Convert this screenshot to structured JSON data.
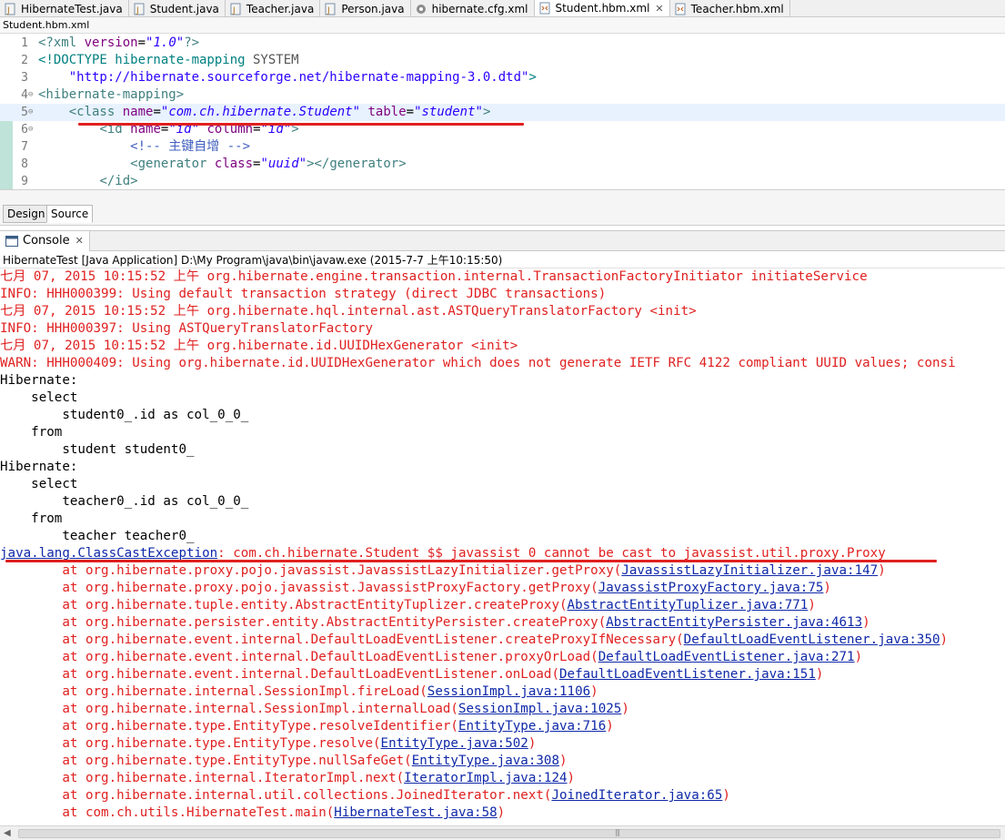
{
  "editor_tabs": [
    {
      "label": "HibernateTest.java",
      "icon": "java-file-icon"
    },
    {
      "label": "Student.java",
      "icon": "java-file-icon"
    },
    {
      "label": "Teacher.java",
      "icon": "java-file-icon"
    },
    {
      "label": "Person.java",
      "icon": "java-file-icon"
    },
    {
      "label": "hibernate.cfg.xml",
      "icon": "hibernate-config-icon"
    },
    {
      "label": "Student.hbm.xml",
      "icon": "xml-file-icon",
      "active": true
    },
    {
      "label": "Teacher.hbm.xml",
      "icon": "xml-file-icon"
    }
  ],
  "editor": {
    "title": "Student.hbm.xml",
    "lines": [
      {
        "num": "1",
        "text": "<?xml version=\"1.0\"?>"
      },
      {
        "num": "2",
        "text": "<!DOCTYPE hibernate-mapping SYSTEM"
      },
      {
        "num": "3",
        "text": "    \"http://hibernate.sourceforge.net/hibernate-mapping-3.0.dtd\">"
      },
      {
        "num": "4",
        "text": "<hibernate-mapping>"
      },
      {
        "num": "5",
        "text": "    <class name=\"com.ch.hibernate.Student\" table=\"student\">"
      },
      {
        "num": "6",
        "text": "        <id name=\"id\" column=\"id\">"
      },
      {
        "num": "7",
        "text": "            <!-- 主键自增 -->"
      },
      {
        "num": "8",
        "text": "            <generator class=\"uuid\"></generator>"
      },
      {
        "num": "9",
        "text": "        </id>"
      }
    ],
    "bottom_tabs": {
      "design": "Design",
      "source": "Source"
    }
  },
  "console": {
    "tab_label": "Console",
    "description": "HibernateTest [Java Application] D:\\My Program\\java\\bin\\javaw.exe (2015-7-7 上午10:15:50)",
    "lines": [
      {
        "type": "err",
        "text": "七月 07, 2015 10:15:52 上午 org.hibernate.engine.transaction.internal.TransactionFactoryInitiator initiateService"
      },
      {
        "type": "err",
        "text": "INFO: HHH000399: Using default transaction strategy (direct JDBC transactions)"
      },
      {
        "type": "err",
        "text": "七月 07, 2015 10:15:52 上午 org.hibernate.hql.internal.ast.ASTQueryTranslatorFactory <init>"
      },
      {
        "type": "err",
        "text": "INFO: HHH000397: Using ASTQueryTranslatorFactory"
      },
      {
        "type": "err",
        "text": "七月 07, 2015 10:15:52 上午 org.hibernate.id.UUIDHexGenerator <init>"
      },
      {
        "type": "err",
        "text": "WARN: HHH000409: Using org.hibernate.id.UUIDHexGenerator which does not generate IETF RFC 4122 compliant UUID values; consi"
      },
      {
        "type": "out",
        "text": "Hibernate: "
      },
      {
        "type": "out",
        "text": "    select"
      },
      {
        "type": "out",
        "text": "        student0_.id as col_0_0_ "
      },
      {
        "type": "out",
        "text": "    from"
      },
      {
        "type": "out",
        "text": "        student student0_"
      },
      {
        "type": "out",
        "text": "Hibernate: "
      },
      {
        "type": "out",
        "text": "    select"
      },
      {
        "type": "out",
        "text": "        teacher0_.id as col_0_0_ "
      },
      {
        "type": "out",
        "text": "    from"
      },
      {
        "type": "out",
        "text": "        teacher teacher0_"
      }
    ],
    "exception": {
      "class": "java.lang.ClassCastException",
      "message": ": com.ch.hibernate.Student_$$_javassist_0 cannot be cast to javassist.util.proxy.Proxy"
    },
    "stack": [
      {
        "prefix": "        at org.hibernate.proxy.pojo.javassist.JavassistLazyInitializer.getProxy(",
        "link": "JavassistLazyInitializer.java:147"
      },
      {
        "prefix": "        at org.hibernate.proxy.pojo.javassist.JavassistProxyFactory.getProxy(",
        "link": "JavassistProxyFactory.java:75"
      },
      {
        "prefix": "        at org.hibernate.tuple.entity.AbstractEntityTuplizer.createProxy(",
        "link": "AbstractEntityTuplizer.java:771"
      },
      {
        "prefix": "        at org.hibernate.persister.entity.AbstractEntityPersister.createProxy(",
        "link": "AbstractEntityPersister.java:4613"
      },
      {
        "prefix": "        at org.hibernate.event.internal.DefaultLoadEventListener.createProxyIfNecessary(",
        "link": "DefaultLoadEventListener.java:350"
      },
      {
        "prefix": "        at org.hibernate.event.internal.DefaultLoadEventListener.proxyOrLoad(",
        "link": "DefaultLoadEventListener.java:271"
      },
      {
        "prefix": "        at org.hibernate.event.internal.DefaultLoadEventListener.onLoad(",
        "link": "DefaultLoadEventListener.java:151"
      },
      {
        "prefix": "        at org.hibernate.internal.SessionImpl.fireLoad(",
        "link": "SessionImpl.java:1106"
      },
      {
        "prefix": "        at org.hibernate.internal.SessionImpl.internalLoad(",
        "link": "SessionImpl.java:1025"
      },
      {
        "prefix": "        at org.hibernate.type.EntityType.resolveIdentifier(",
        "link": "EntityType.java:716"
      },
      {
        "prefix": "        at org.hibernate.type.EntityType.resolve(",
        "link": "EntityType.java:502"
      },
      {
        "prefix": "        at org.hibernate.type.EntityType.nullSafeGet(",
        "link": "EntityType.java:308"
      },
      {
        "prefix": "        at org.hibernate.internal.IteratorImpl.next(",
        "link": "IteratorImpl.java:124"
      },
      {
        "prefix": "        at org.hibernate.internal.util.collections.JoinedIterator.next(",
        "link": "JoinedIterator.java:65"
      },
      {
        "prefix": "        at com.ch.utils.HibernateTest.main(",
        "link": "HibernateTest.java:58"
      }
    ],
    "colors": {
      "stderr": "#e02020",
      "link": "#0f28a8",
      "annotation": "#e02020"
    }
  }
}
